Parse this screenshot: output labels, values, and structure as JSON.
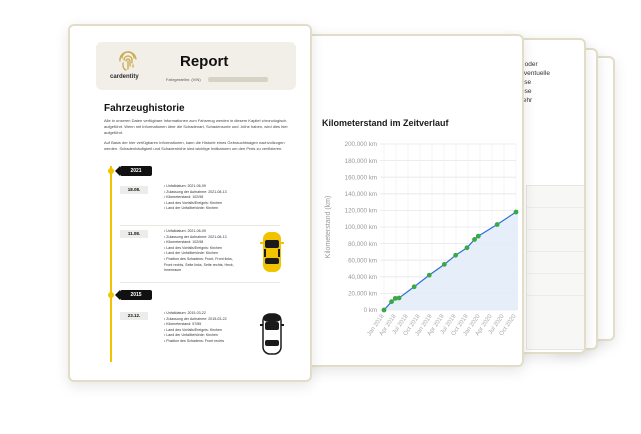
{
  "page2": {
    "fragments": [
      "den oder",
      "ss eventuelle",
      "",
      "",
      "t diese",
      "",
      "r diese",
      "",
      "ft mehr"
    ]
  },
  "chart_page": {
    "title": "Kilometerstand im Zeitverlauf"
  },
  "chart_data": {
    "type": "line",
    "title": "Kilometerstand im Zeitverlauf",
    "ylabel": "Kilometerstand (km)",
    "xlabel": "",
    "ylim": [
      0,
      200000
    ],
    "y_ticks": [
      "0 km",
      "20,000 km",
      "40,000 km",
      "60,000 km",
      "80,000 km",
      "100,000 km",
      "120,000 km",
      "140,000 km",
      "160,000 km",
      "180,000 km",
      "200,000 km"
    ],
    "x_ticks": [
      "Jan 2018",
      "Apr 2018",
      "Jul 2018",
      "Oct 2018",
      "Jan 2019",
      "Apr 2019",
      "Jul 2019",
      "Oct 2019",
      "Jan 2020",
      "Apr 2020",
      "Jul 2020",
      "Oct 2020"
    ],
    "grid": true,
    "line_color": "#2a6fd6",
    "fill_color": "#e3ecfa",
    "marker_color": "#3aa845",
    "points": [
      {
        "x": "2018-01",
        "y": 0
      },
      {
        "x": "2018-03",
        "y": 10000
      },
      {
        "x": "2018-04",
        "y": 14000
      },
      {
        "x": "2018-05",
        "y": 14500
      },
      {
        "x": "2018-09",
        "y": 28000
      },
      {
        "x": "2019-01",
        "y": 42000
      },
      {
        "x": "2019-05",
        "y": 55000
      },
      {
        "x": "2019-08",
        "y": 66000
      },
      {
        "x": "2019-11",
        "y": 75000
      },
      {
        "x": "2020-01",
        "y": 85000
      },
      {
        "x": "2020-02",
        "y": 89000
      },
      {
        "x": "2020-07",
        "y": 103000
      },
      {
        "x": "2020-12",
        "y": 118000
      }
    ]
  },
  "report": {
    "logo_text": "cardentity",
    "title": "Report",
    "subtitle": "Fahrgestellnr. (VIN)",
    "section_title": "Fahrzeughistorie",
    "intro_p1": "Alle in unseren Daten verfügbare Informationen zum Fahrzeug werden in diesem Kapitel chronologisch aufgeführt. Wenn mit Informationen über die Schadenart, Schadensorte und -höhe haben, wird dies hier aufgeführt.",
    "intro_p2": "Auf Basis der hier verfügbaren Informationen, kann die Historie eines Gebrauchtwagen nachvollzogen werden. Schadenhäufigkeit und Schadenhöhe sind wichtige Indikatoren um den Preis zu verifizieren.",
    "years": [
      {
        "year": "2021",
        "entries": [
          {
            "date": "18.08.",
            "items": [
              "Unfalldatum: 2021-06-09",
              "Zulassung der Aufnahme: 2021-08-13",
              "Kilometerstand: 102/98",
              "Land des Vorfalls/Ereignis: Kirchen",
              "Land der Unfallbehörde: Kirchen"
            ]
          },
          {
            "date": "11.08.",
            "items": [
              "Unfalldatum: 2021-06-09",
              "Zulassung der Aufnahme: 2021-08-13",
              "Kilometerstand: 102/98",
              "Land des Vorfalls/Ereignis: Kirchen",
              "Land der Unfallbehörde: Kirchen",
              "Position des Schadens: Front, Front links, Front rechts, Seite links, Seite rechts, Heck, Innenraum"
            ]
          }
        ]
      },
      {
        "year": "2015",
        "entries": [
          {
            "date": "23.12.",
            "items": [
              "Unfalldatum: 2015-03-22",
              "Zulassung der Aufnahme: 2015-03-22",
              "Kilometerstand: 57/85",
              "Land des Vorfalls/Ereignis: Kirchen",
              "Land der Unfallbehörde: Kirchen",
              "Position des Schadens: Front rechts"
            ]
          }
        ]
      }
    ],
    "colors": {
      "accent": "#f2c400",
      "badge": "#111111"
    }
  }
}
